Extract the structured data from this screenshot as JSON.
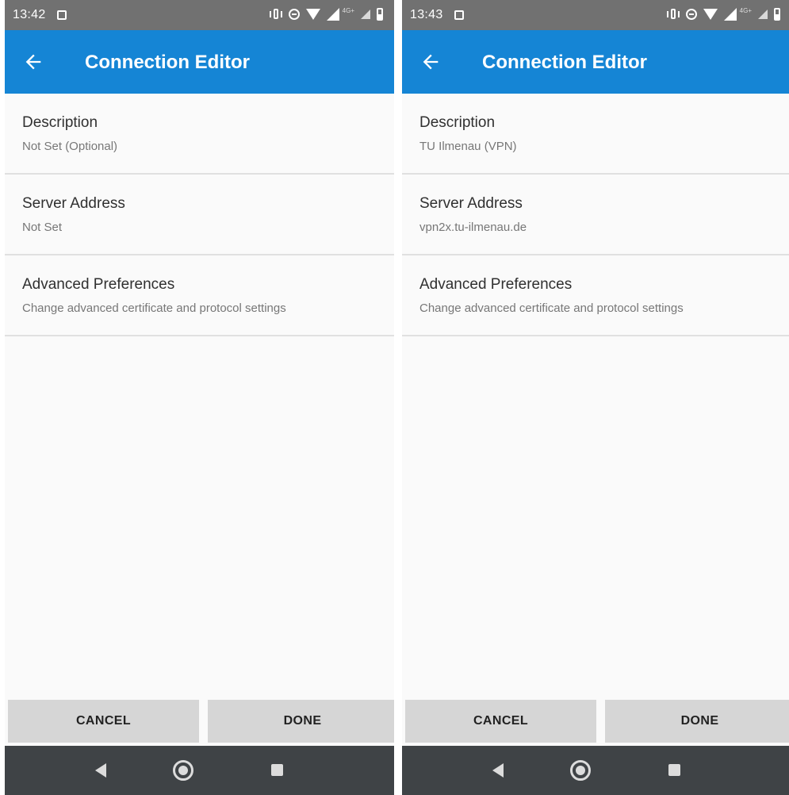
{
  "left_screen": {
    "status_bar": {
      "time": "13:42",
      "network_label": "4G+"
    },
    "app_bar": {
      "title": "Connection Editor",
      "back_icon": "arrow-left-icon"
    },
    "preferences": [
      {
        "title": "Description",
        "summary": "Not Set (Optional)"
      },
      {
        "title": "Server Address",
        "summary": "Not Set"
      },
      {
        "title": "Advanced Preferences",
        "summary": "Change advanced certificate and protocol settings"
      }
    ],
    "buttons": {
      "cancel": "CANCEL",
      "done": "DONE"
    },
    "nav_bar": {
      "icons": [
        "nav-back-icon",
        "nav-home-icon",
        "nav-recents-icon"
      ]
    }
  },
  "right_screen": {
    "status_bar": {
      "time": "13:43",
      "network_label": "4G+"
    },
    "app_bar": {
      "title": "Connection Editor",
      "back_icon": "arrow-left-icon"
    },
    "preferences": [
      {
        "title": "Description",
        "summary": "TU Ilmenau (VPN)"
      },
      {
        "title": "Server Address",
        "summary": "vpn2x.tu-ilmenau.de"
      },
      {
        "title": "Advanced Preferences",
        "summary": "Change advanced certificate and protocol settings"
      }
    ],
    "buttons": {
      "cancel": "CANCEL",
      "done": "DONE"
    },
    "nav_bar": {
      "icons": [
        "nav-back-icon",
        "nav-home-icon",
        "nav-recents-icon"
      ]
    }
  },
  "colors": {
    "app_bar": "#1585d5",
    "status_bar": "#717171",
    "nav_bar": "#3f4346",
    "button": "#d6d6d6",
    "background": "#fafafa"
  }
}
